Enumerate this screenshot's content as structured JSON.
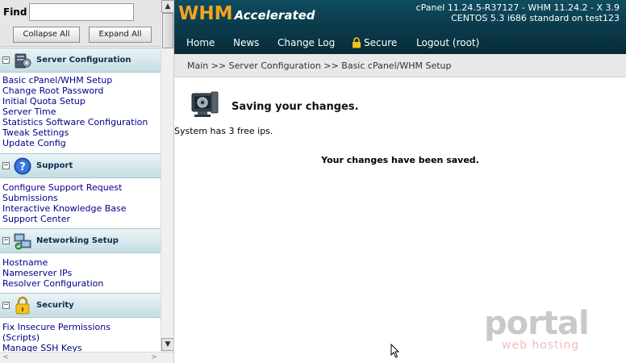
{
  "sidebar": {
    "find_label": "Find",
    "find_value": "",
    "collapse_all": "Collapse All",
    "expand_all": "Expand All",
    "sections": [
      {
        "title": "Server Configuration",
        "toggle": "−",
        "icon": "server-config-icon",
        "items": [
          "Basic cPanel/WHM Setup",
          "Change Root Password",
          "Initial Quota Setup",
          "Server Time",
          "Statistics Software Configuration",
          "Tweak Settings",
          "Update Config"
        ]
      },
      {
        "title": "Support",
        "toggle": "−",
        "icon": "help-icon",
        "items": [
          "Configure Support Request",
          "Submissions",
          "Interactive Knowledge Base",
          "Support Center"
        ]
      },
      {
        "title": "Networking Setup",
        "toggle": "−",
        "icon": "network-icon",
        "items": [
          "Hostname",
          "Nameserver IPs",
          "Resolver Configuration"
        ]
      },
      {
        "title": "Security",
        "toggle": "−",
        "icon": "lock-icon",
        "items": [
          "Fix Insecure Permissions",
          "(Scripts)",
          "Manage SSH Keys"
        ]
      }
    ]
  },
  "header": {
    "logo_main": "WHM",
    "logo_sub": "Accelerated",
    "version_line1": "cPanel 11.24.5-R37127 - WHM 11.24.2 - X 3.9",
    "version_line2": "CENTOS 5.3 i686 standard on test123",
    "nav": {
      "home": "Home",
      "news": "News",
      "change_log": "Change Log",
      "secure": "Secure",
      "logout": "Logout (root)"
    }
  },
  "breadcrumb": "Main >> Server Configuration >> Basic cPanel/WHM Setup",
  "content": {
    "title": "Saving your changes.",
    "free_ips": "System has 3 free ips.",
    "saved_message": "Your changes have been saved."
  },
  "watermark": {
    "main": "portal",
    "sub": "web hosting"
  },
  "colors": {
    "header_bg": "#0f4c60",
    "nav_bg": "#062b38",
    "logo_orange": "#f3a321",
    "link_blue": "#00008b",
    "section_header": "#c5dde3"
  }
}
